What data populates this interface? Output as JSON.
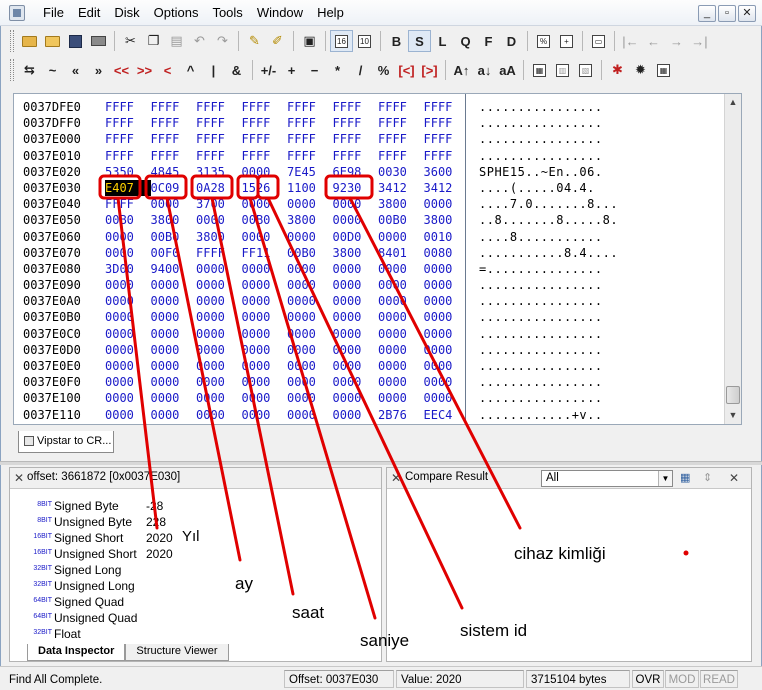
{
  "window": {
    "menus": [
      "File",
      "Edit",
      "Disk",
      "Options",
      "Tools",
      "Window",
      "Help"
    ],
    "controls": {
      "minimize": "_",
      "maximize": "▫",
      "close": "✕"
    }
  },
  "toolbar_top": {
    "mode_letters": [
      "B",
      "S",
      "L",
      "Q",
      "F",
      "D"
    ]
  },
  "toolbar_ops": {
    "ops": [
      "⇆",
      "~",
      "«",
      "»",
      "<<",
      ">>",
      "<",
      "^",
      "|",
      "&",
      "+/-",
      "+",
      "−",
      "*",
      "/",
      "%",
      "[<]",
      "[>]",
      "A↑",
      "a↓",
      "aA"
    ]
  },
  "hex_view": {
    "rows": [
      {
        "offset": "0037DFE0",
        "cells": [
          "FFFF",
          "FFFF",
          "FFFF",
          "FFFF",
          "FFFF",
          "FFFF",
          "FFFF",
          "FFFF"
        ],
        "ascii": "................"
      },
      {
        "offset": "0037DFF0",
        "cells": [
          "FFFF",
          "FFFF",
          "FFFF",
          "FFFF",
          "FFFF",
          "FFFF",
          "FFFF",
          "FFFF"
        ],
        "ascii": "................"
      },
      {
        "offset": "0037E000",
        "cells": [
          "FFFF",
          "FFFF",
          "FFFF",
          "FFFF",
          "FFFF",
          "FFFF",
          "FFFF",
          "FFFF"
        ],
        "ascii": "................"
      },
      {
        "offset": "0037E010",
        "cells": [
          "FFFF",
          "FFFF",
          "FFFF",
          "FFFF",
          "FFFF",
          "FFFF",
          "FFFF",
          "FFFF"
        ],
        "ascii": "................"
      },
      {
        "offset": "0037E020",
        "cells": [
          "5350",
          "4845",
          "3135",
          "0000",
          "7E45",
          "6E98",
          "0030",
          "3600"
        ],
        "ascii": "SPHE15..~En..06."
      },
      {
        "offset": "0037E030",
        "cells": [
          "E407",
          "0C09",
          "0A28",
          "1526",
          "1100",
          "9230",
          "3412",
          "3412"
        ],
        "ascii": "....(.....04.4."
      },
      {
        "offset": "0037E040",
        "cells": [
          "FFFF",
          "0000",
          "3700",
          "0000",
          "0000",
          "0000",
          "3800",
          "0000"
        ],
        "ascii": "....7.0.......8..."
      },
      {
        "offset": "0037E050",
        "cells": [
          "00B0",
          "3800",
          "0000",
          "00B0",
          "3800",
          "0000",
          "00B0",
          "3800"
        ],
        "ascii": "..8.......8.....8."
      },
      {
        "offset": "0037E060",
        "cells": [
          "0000",
          "00B0",
          "3800",
          "0000",
          "0000",
          "00D0",
          "0000",
          "0010"
        ],
        "ascii": "....8..........."
      },
      {
        "offset": "0037E070",
        "cells": [
          "0000",
          "00F0",
          "FFFF",
          "FF11",
          "00B0",
          "3800",
          "8401",
          "0080"
        ],
        "ascii": "...........8.4...."
      },
      {
        "offset": "0037E080",
        "cells": [
          "3D00",
          "9400",
          "0000",
          "0000",
          "0000",
          "0000",
          "0000",
          "0000"
        ],
        "ascii": "=..............."
      },
      {
        "offset": "0037E090",
        "cells": [
          "0000",
          "0000",
          "0000",
          "0000",
          "0000",
          "0000",
          "0000",
          "0000"
        ],
        "ascii": "................"
      },
      {
        "offset": "0037E0A0",
        "cells": [
          "0000",
          "0000",
          "0000",
          "0000",
          "0000",
          "0000",
          "0000",
          "0000"
        ],
        "ascii": "................"
      },
      {
        "offset": "0037E0B0",
        "cells": [
          "0000",
          "0000",
          "0000",
          "0000",
          "0000",
          "0000",
          "0000",
          "0000"
        ],
        "ascii": "................"
      },
      {
        "offset": "0037E0C0",
        "cells": [
          "0000",
          "0000",
          "0000",
          "0000",
          "0000",
          "0000",
          "0000",
          "0000"
        ],
        "ascii": "................"
      },
      {
        "offset": "0037E0D0",
        "cells": [
          "0000",
          "0000",
          "0000",
          "0000",
          "0000",
          "0000",
          "0000",
          "0000"
        ],
        "ascii": "................"
      },
      {
        "offset": "0037E0E0",
        "cells": [
          "0000",
          "0000",
          "0000",
          "0000",
          "0000",
          "0000",
          "0000",
          "0000"
        ],
        "ascii": "................"
      },
      {
        "offset": "0037E0F0",
        "cells": [
          "0000",
          "0000",
          "0000",
          "0000",
          "0000",
          "0000",
          "0000",
          "0000"
        ],
        "ascii": "................"
      },
      {
        "offset": "0037E100",
        "cells": [
          "0000",
          "0000",
          "0000",
          "0000",
          "0000",
          "0000",
          "0000",
          "0000"
        ],
        "ascii": "................"
      },
      {
        "offset": "0037E110",
        "cells": [
          "0000",
          "0000",
          "0000",
          "0000",
          "0000",
          "0000",
          "2B76",
          "EEC4"
        ],
        "ascii": "............+v.."
      }
    ],
    "selected_cell": "E407"
  },
  "doc_tab": {
    "label": "Vipstar to CR..."
  },
  "inspector": {
    "offset_text": "offset: 3661872 [0x0037E030]",
    "rows": [
      {
        "bits": "8BIT",
        "label": "Signed Byte",
        "value": "-28"
      },
      {
        "bits": "8BIT",
        "label": "Unsigned Byte",
        "value": "228"
      },
      {
        "bits": "16BIT",
        "label": "Signed Short",
        "value": "2020"
      },
      {
        "bits": "16BIT",
        "label": "Unsigned Short",
        "value": "2020"
      },
      {
        "bits": "32BIT",
        "label": "Signed Long",
        "value": ""
      },
      {
        "bits": "32BIT",
        "label": "Unsigned Long",
        "value": ""
      },
      {
        "bits": "64BIT",
        "label": "Signed Quad",
        "value": ""
      },
      {
        "bits": "64BIT",
        "label": "Unsigned Quad",
        "value": ""
      },
      {
        "bits": "32BIT",
        "label": "Float",
        "value": ""
      }
    ],
    "tabs": [
      "Data Inspector",
      "Structure Viewer"
    ]
  },
  "compare": {
    "title": "Compare Result",
    "filter": "All"
  },
  "status": {
    "message": "Find All Complete.",
    "offset": "Offset: 0037E030",
    "value": "Value: 2020",
    "size": "3715104 bytes",
    "ovr": "OVR",
    "mod": "MOD",
    "read": "READ"
  },
  "annotations": {
    "yil": "Yıl",
    "ay": "ay",
    "saat": "saat",
    "saniye": "saniye",
    "sistem_id": "sistem id",
    "cihaz_kimligi": "cihaz kimliği",
    "color": "#e00000"
  }
}
